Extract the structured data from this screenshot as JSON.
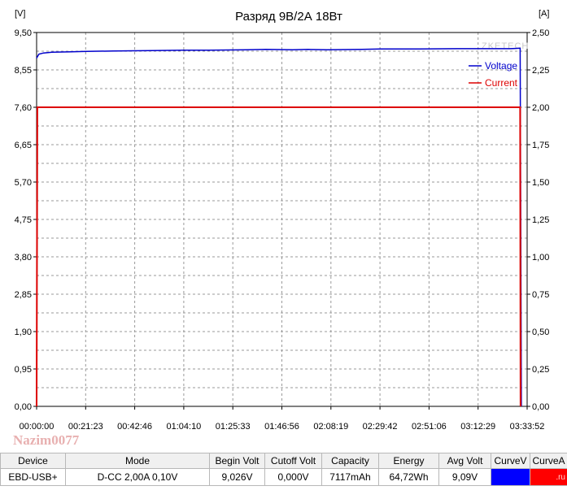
{
  "chart_data": {
    "type": "line",
    "title": "Разряд 9В/2А   18Вт",
    "left_axis_unit": "[V]",
    "right_axis_unit": "[A]",
    "left_ticks": [
      "9,50",
      "8,55",
      "7,60",
      "6,65",
      "5,70",
      "4,75",
      "3,80",
      "2,85",
      "1,90",
      "0,95",
      "0,00"
    ],
    "right_ticks": [
      "2,50",
      "2,25",
      "2,00",
      "1,75",
      "1,50",
      "1,25",
      "1,00",
      "0,75",
      "0,50",
      "0,25",
      "0,00"
    ],
    "x_ticks": [
      "00:00:00",
      "00:21:23",
      "00:42:46",
      "01:04:10",
      "01:25:33",
      "01:46:56",
      "02:08:19",
      "02:29:42",
      "02:51:06",
      "03:12:29",
      "03:33:52"
    ],
    "x_range_seconds": [
      0,
      12832
    ],
    "ylim_left": [
      0,
      9.5
    ],
    "ylim_right": [
      0,
      2.5
    ],
    "grid": true,
    "legend_position": "top-right",
    "watermark": "ZKETECH",
    "series": [
      {
        "name": "Voltage",
        "axis": "left",
        "color": "#0000cc",
        "x": [
          0,
          60,
          180,
          400,
          900,
          1300,
          2000,
          3000,
          3850,
          4500,
          5500,
          6000,
          6700,
          7100,
          7600,
          8500,
          9000,
          10000,
          11000,
          11800,
          12400,
          12600,
          12650,
          12680
        ],
        "y": [
          8.85,
          8.95,
          8.98,
          9.0,
          9.01,
          9.02,
          9.03,
          9.04,
          9.05,
          9.05,
          9.06,
          9.07,
          9.06,
          9.07,
          9.06,
          9.07,
          9.08,
          9.08,
          9.09,
          9.09,
          9.09,
          9.1,
          9.1,
          0.0
        ]
      },
      {
        "name": "Current",
        "axis": "right",
        "color": "#dd0000",
        "x": [
          0,
          20,
          12650,
          12660
        ],
        "y": [
          0.0,
          2.0,
          2.0,
          0.0
        ]
      }
    ]
  },
  "nickname": "Nazim0077",
  "info_table": {
    "headers": [
      "Device",
      "Mode",
      "Begin Volt",
      "Cutoff Volt",
      "Capacity",
      "Energy",
      "Avg Volt",
      "CurveV",
      "CurveA"
    ],
    "row": [
      "EBD-USB+",
      "D-CC  2,00A  0,10V",
      "9,026V",
      "0,000V",
      "7117mAh",
      "64,72Wh",
      "9,09V",
      "",
      ".ru"
    ]
  }
}
